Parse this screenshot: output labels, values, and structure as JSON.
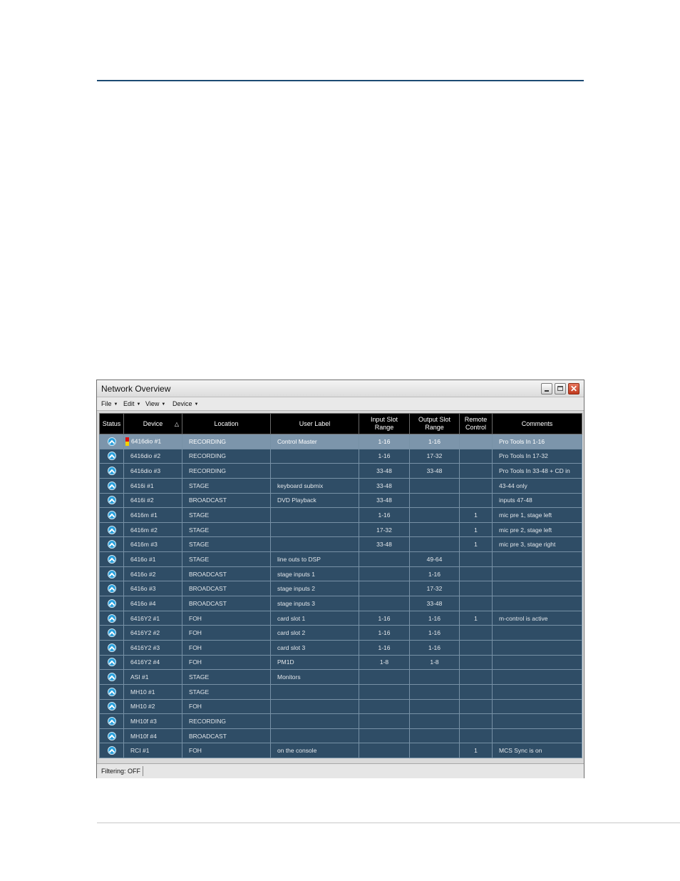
{
  "window": {
    "title": "Network Overview"
  },
  "menus": [
    {
      "label": "File",
      "arrow": "▼"
    },
    {
      "label": "Edit",
      "arrow": "▼"
    },
    {
      "label": "View",
      "arrow": "▼"
    },
    {
      "label": "Device",
      "arrow": "▼"
    }
  ],
  "columns": {
    "status": "Status",
    "device": "Device",
    "location": "Location",
    "user_label": "User Label",
    "input_slot_1": "Input Slot",
    "input_slot_2": "Range",
    "output_slot_1": "Output Slot",
    "output_slot_2": "Range",
    "remote_1": "Remote",
    "remote_2": "Control",
    "comments": "Comments",
    "sort_arrow": "△"
  },
  "rows": [
    {
      "device": "6416dio #1",
      "location": "RECORDING",
      "label": "Control Master",
      "input": "1-16",
      "output": "1-16",
      "remote": "",
      "comments": "Pro Tools In 1-16"
    },
    {
      "device": "6416dio #2",
      "location": "RECORDING",
      "label": "",
      "input": "1-16",
      "output": "17-32",
      "remote": "",
      "comments": "Pro Tools In 17-32"
    },
    {
      "device": "6416dio #3",
      "location": "RECORDING",
      "label": "",
      "input": "33-48",
      "output": "33-48",
      "remote": "",
      "comments": "Pro Tools In 33-48 + CD in"
    },
    {
      "device": "6416i #1",
      "location": "STAGE",
      "label": "keyboard submix",
      "input": "33-48",
      "output": "",
      "remote": "",
      "comments": "43-44 only"
    },
    {
      "device": "6416i #2",
      "location": "BROADCAST",
      "label": "DVD Playback",
      "input": "33-48",
      "output": "",
      "remote": "",
      "comments": "inputs 47-48"
    },
    {
      "device": "6416m #1",
      "location": "STAGE",
      "label": "",
      "input": "1-16",
      "output": "",
      "remote": "1",
      "comments": "mic pre 1, stage left"
    },
    {
      "device": "6416m #2",
      "location": "STAGE",
      "label": "",
      "input": "17-32",
      "output": "",
      "remote": "1",
      "comments": "mic pre 2, stage left"
    },
    {
      "device": "6416m #3",
      "location": "STAGE",
      "label": "",
      "input": "33-48",
      "output": "",
      "remote": "1",
      "comments": "mic pre 3, stage right"
    },
    {
      "device": "6416o #1",
      "location": "STAGE",
      "label": "line outs to DSP",
      "input": "",
      "output": "49-64",
      "remote": "",
      "comments": ""
    },
    {
      "device": "6416o #2",
      "location": "BROADCAST",
      "label": "stage inputs 1",
      "input": "",
      "output": "1-16",
      "remote": "",
      "comments": ""
    },
    {
      "device": "6416o #3",
      "location": "BROADCAST",
      "label": "stage inputs 2",
      "input": "",
      "output": "17-32",
      "remote": "",
      "comments": ""
    },
    {
      "device": "6416o #4",
      "location": "BROADCAST",
      "label": "stage inputs 3",
      "input": "",
      "output": "33-48",
      "remote": "",
      "comments": ""
    },
    {
      "device": "6416Y2 #1",
      "location": "FOH",
      "label": "card slot 1",
      "input": "1-16",
      "output": "1-16",
      "remote": "1",
      "comments": "m-control is active"
    },
    {
      "device": "6416Y2 #2",
      "location": "FOH",
      "label": "card slot 2",
      "input": "1-16",
      "output": "1-16",
      "remote": "",
      "comments": ""
    },
    {
      "device": "6416Y2 #3",
      "location": "FOH",
      "label": "card slot 3",
      "input": "1-16",
      "output": "1-16",
      "remote": "",
      "comments": ""
    },
    {
      "device": "6416Y2 #4",
      "location": "FOH",
      "label": "PM1D",
      "input": "1-8",
      "output": "1-8",
      "remote": "",
      "comments": ""
    },
    {
      "device": "ASI #1",
      "location": "STAGE",
      "label": "Monitors",
      "input": "",
      "output": "",
      "remote": "",
      "comments": ""
    },
    {
      "device": "MH10 #1",
      "location": "STAGE",
      "label": "",
      "input": "",
      "output": "",
      "remote": "",
      "comments": ""
    },
    {
      "device": "MH10 #2",
      "location": "FOH",
      "label": "",
      "input": "",
      "output": "",
      "remote": "",
      "comments": ""
    },
    {
      "device": "MH10f #3",
      "location": "RECORDING",
      "label": "",
      "input": "",
      "output": "",
      "remote": "",
      "comments": ""
    },
    {
      "device": "MH10f #4",
      "location": "BROADCAST",
      "label": "",
      "input": "",
      "output": "",
      "remote": "",
      "comments": ""
    },
    {
      "device": "RCI #1",
      "location": "FOH",
      "label": "on the console",
      "input": "",
      "output": "",
      "remote": "1",
      "comments": "MCS Sync is on"
    }
  ],
  "selected_row": 0,
  "statusbar": {
    "filtering": "Filtering: OFF"
  },
  "colors": {
    "row_bg": "#2f4d66",
    "selected_bg": "#7c95ab",
    "header_bg": "#000000",
    "status_icon": "#2aa0dc",
    "alert_red": "#e01010",
    "alert_yellow": "#f4d000"
  }
}
